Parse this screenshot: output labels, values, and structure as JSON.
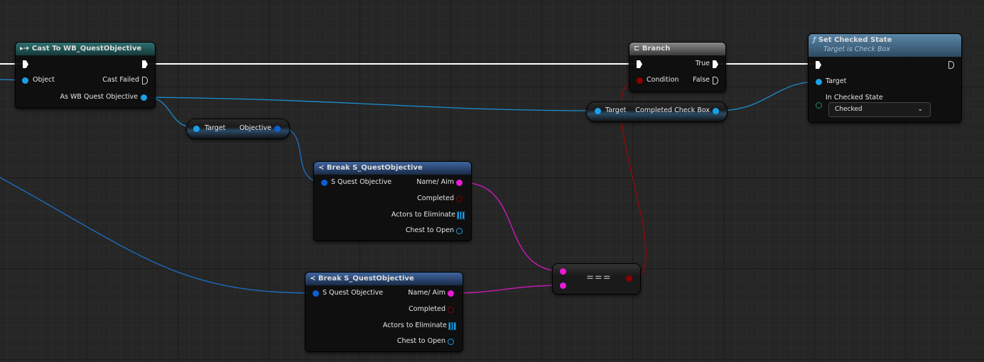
{
  "colors": {
    "exec": "#ffffff",
    "object": "#1aa0e8",
    "struct": "#0d5ed1",
    "string": "#ea1ad6",
    "bool": "#8b0000",
    "array": "#1aa0e8"
  },
  "cast_node": {
    "icon": "cast-icon",
    "title": "Cast To WB_QuestObjective",
    "object_label": "Object",
    "cast_failed_label": "Cast Failed",
    "as_label": "As WB Quest Objective"
  },
  "get_objective": {
    "target_label": "Target",
    "objective_label": "Objective"
  },
  "branch_node": {
    "icon": "branch-icon",
    "title": "Branch",
    "true_label": "True",
    "condition_label": "Condition",
    "false_label": "False"
  },
  "get_checkbox": {
    "target_label": "Target",
    "output_label": "Completed Check Box"
  },
  "set_checked": {
    "icon": "function-icon",
    "title": "Set Checked State",
    "subtitle": "Target is Check Box",
    "target_label": "Target",
    "state_label": "In Checked State",
    "state_value": "Checked"
  },
  "break_nodes": [
    {
      "title": "Break S_QuestObjective",
      "input_label": "S Quest Objective",
      "outputs": [
        "Name/ Aim",
        "Completed",
        "Actors to Eliminate",
        "Chest to Open"
      ]
    },
    {
      "title": "Break S_QuestObjective",
      "input_label": "S Quest Objective",
      "outputs": [
        "Name/ Aim",
        "Completed",
        "Actors to Eliminate",
        "Chest to Open"
      ]
    }
  ],
  "equal_node": {
    "label": "==="
  }
}
